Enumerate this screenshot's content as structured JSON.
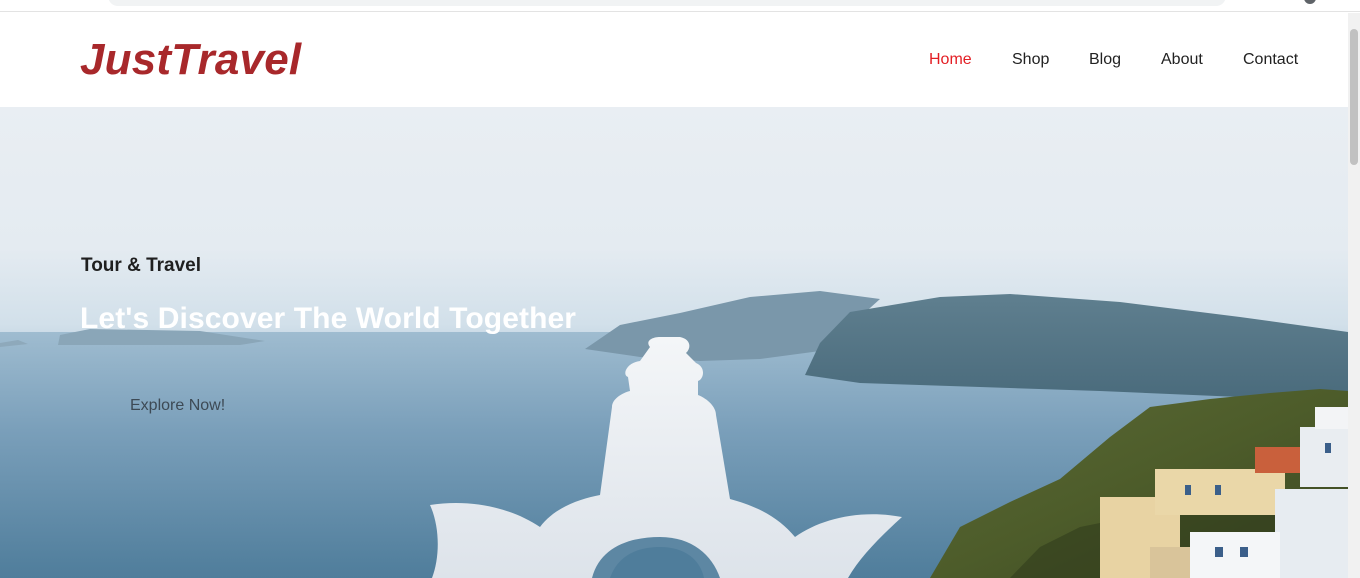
{
  "site": {
    "brand": "JustTravel"
  },
  "nav": {
    "items": [
      {
        "label": "Home",
        "active": true
      },
      {
        "label": "Shop",
        "active": false
      },
      {
        "label": "Blog",
        "active": false
      },
      {
        "label": "About",
        "active": false
      },
      {
        "label": "Contact",
        "active": false
      }
    ]
  },
  "hero": {
    "kicker": "Tour & Travel",
    "title": "Let's Discover The World Together",
    "cta_label": "Explore Now!"
  },
  "colors": {
    "brand": "#a8282b",
    "nav_active": "#e31e24",
    "nav_text": "#222222",
    "hero_title": "#ffffff"
  }
}
